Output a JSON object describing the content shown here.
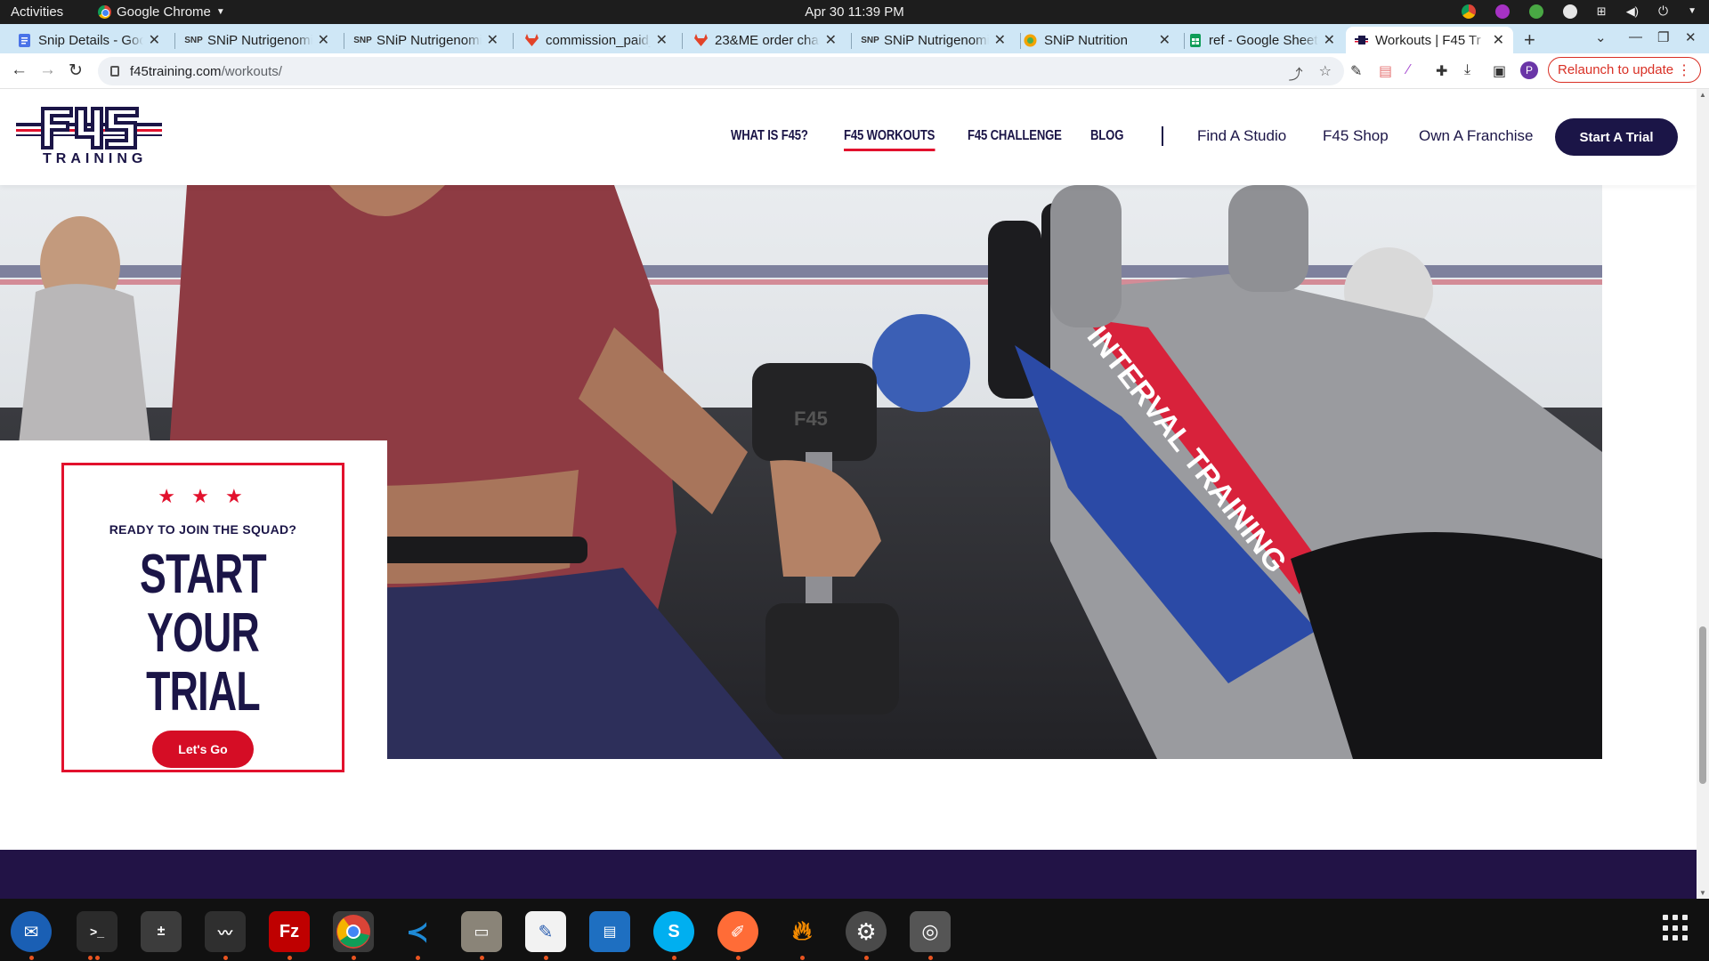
{
  "system_bar": {
    "activities": "Activities",
    "app_name": "Google Chrome",
    "clock": "Apr 30  11:39 PM"
  },
  "tabs": [
    {
      "title": "Snip Details - Goog",
      "icon": "docs-icon",
      "color": "#4a73e8"
    },
    {
      "title": "SNiP Nutrigenomi",
      "icon": "snip-icon",
      "color": "#333333"
    },
    {
      "title": "SNiP Nutrigenomi",
      "icon": "snip-icon",
      "color": "#333333"
    },
    {
      "title": "commission_paid_",
      "icon": "gitlab-icon",
      "color": "#e24329"
    },
    {
      "title": "23&ME order chan",
      "icon": "gitlab-icon",
      "color": "#e24329"
    },
    {
      "title": "SNiP Nutrigenomi",
      "icon": "snip-icon",
      "color": "#333333"
    },
    {
      "title": "SNiP Nutrition",
      "icon": "snip-nutrition-icon",
      "color": "#f4a300"
    },
    {
      "title": "ref - Google Sheet",
      "icon": "sheets-icon",
      "color": "#0f9d58"
    },
    {
      "title": "Workouts | F45 Tr",
      "icon": "f45-icon",
      "color": "#1b1547",
      "active": true
    }
  ],
  "address_bar": {
    "host": "f45training.com",
    "path": "/workouts/"
  },
  "relaunch_label": "Relaunch to update",
  "profile_initial": "P",
  "site": {
    "logo_word": "TRAINING",
    "nav": [
      {
        "label": "WHAT IS F45?"
      },
      {
        "label": "F45 WORKOUTS",
        "active": true
      },
      {
        "label": "F45 CHALLENGE"
      },
      {
        "label": "BLOG"
      }
    ],
    "nav_links": [
      "Find A Studio",
      "F45 Shop",
      "Own A Franchise"
    ],
    "start_trial": "Start A Trial",
    "card": {
      "stars": "★ ★ ★",
      "kicker": "READY TO JOIN THE SQUAD?",
      "headline_1": "START YOUR",
      "headline_2": "TRIAL",
      "cta": "Let's Go"
    },
    "photo_text": {
      "dumbbell_mark": "F45",
      "bench_text": "INTERVAL TRAINING"
    }
  },
  "dock": [
    {
      "name": "thunderbird-icon",
      "color": "#1a5fb4"
    },
    {
      "name": "terminal-icon",
      "color": "#2b2b2b"
    },
    {
      "name": "calculator-icon",
      "color": "#3c3c3c"
    },
    {
      "name": "system-monitor-icon",
      "color": "#2f2f2f"
    },
    {
      "name": "filezilla-icon",
      "color": "#bf0000"
    },
    {
      "name": "chrome-icon",
      "color": "#303030"
    },
    {
      "name": "vscode-icon",
      "color": "#0065a9"
    },
    {
      "name": "files-icon",
      "color": "#7a7a7a"
    },
    {
      "name": "text-editor-icon",
      "color": "#f2f2f2"
    },
    {
      "name": "libreoffice-writer-icon",
      "color": "#1e6fc1"
    },
    {
      "name": "skype-icon",
      "color": "#00aff0"
    },
    {
      "name": "postman-icon",
      "color": "#ff6c37"
    },
    {
      "name": "lightning-icon",
      "color": "#f58b00"
    },
    {
      "name": "settings-icon",
      "color": "#4a4a4a"
    },
    {
      "name": "disk-icon",
      "color": "#555555"
    }
  ]
}
